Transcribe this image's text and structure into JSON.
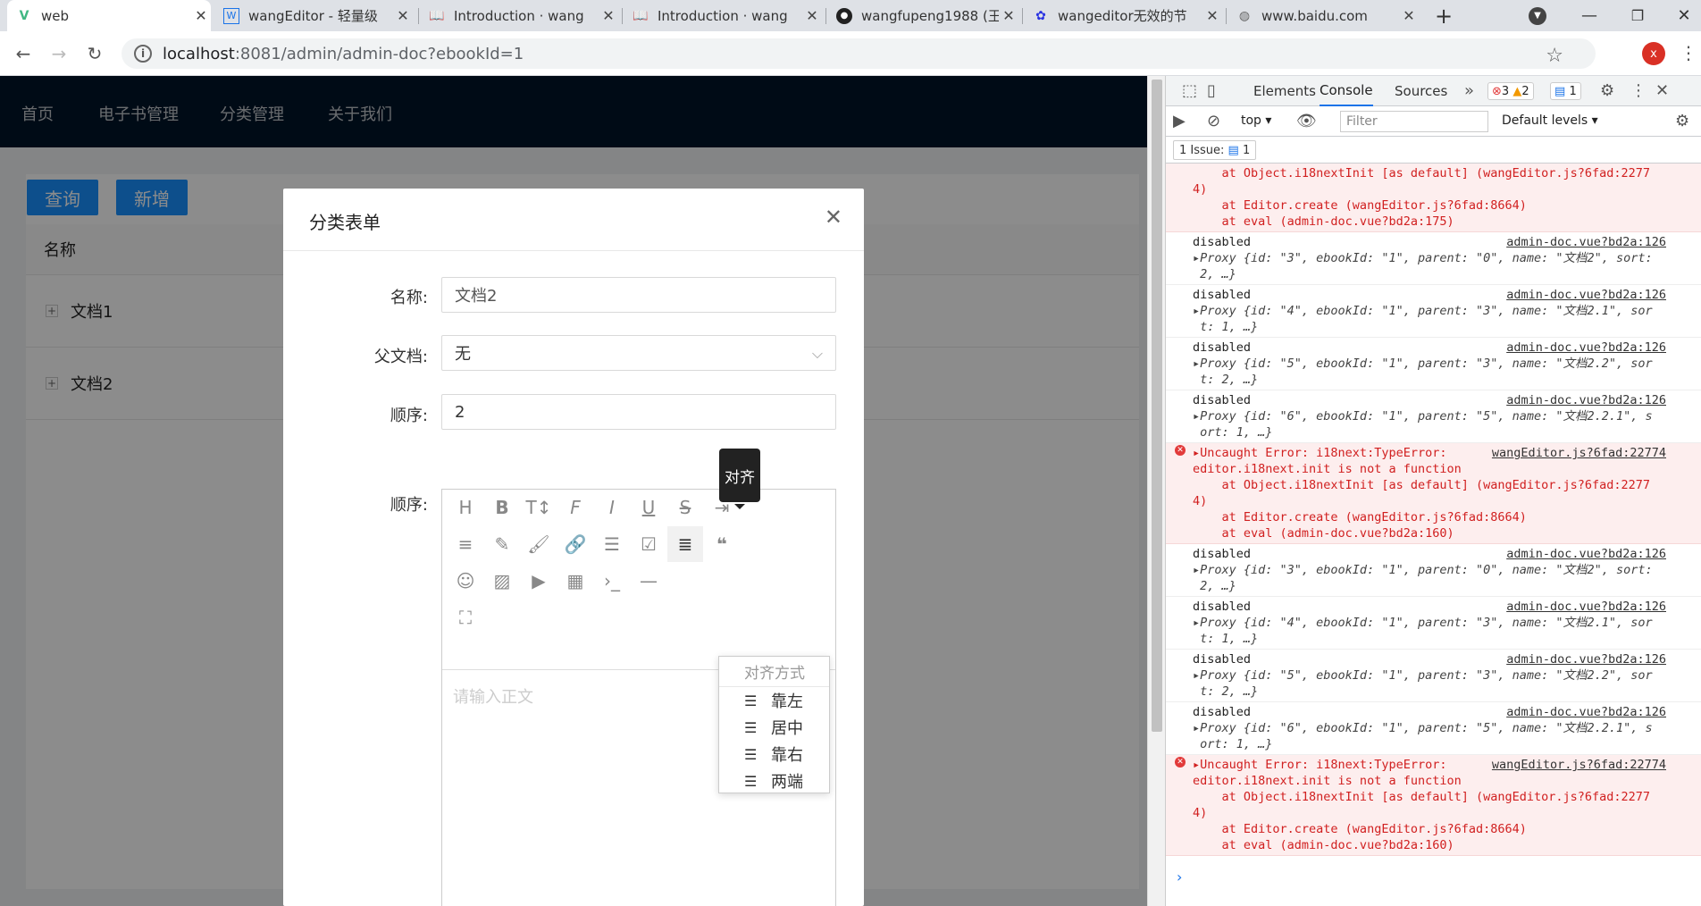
{
  "tabs": [
    {
      "title": "web",
      "icon": "vue-logo-icon"
    },
    {
      "title": "wangEditor - 轻量级",
      "icon": "wangeditor-icon"
    },
    {
      "title": "Introduction · wang",
      "icon": "book-icon"
    },
    {
      "title": "Introduction · wang",
      "icon": "book-icon"
    },
    {
      "title": "wangfupeng1988 (王",
      "icon": "github-icon"
    },
    {
      "title": "wangeditor无效的节",
      "icon": "baidu-paw-icon"
    },
    {
      "title": "www.baidu.com",
      "icon": "globe-icon"
    }
  ],
  "address": {
    "host": "localhost",
    "path": ":8081/admin/admin-doc?ebookId=1",
    "profile_initial": "x"
  },
  "app": {
    "nav": [
      "首页",
      "电子书管理",
      "分类管理",
      "关于我们"
    ],
    "buttons": {
      "query": "查询",
      "add": "新增"
    },
    "table_header": "名称",
    "rows": [
      "文档1",
      "文档2"
    ]
  },
  "modal": {
    "title": "分类表单",
    "fields": {
      "name_label": "名称:",
      "name_value": "文档2",
      "parent_label": "父文档:",
      "parent_value": "无",
      "sort_label": "顺序:",
      "sort_value": "2",
      "content_label": "顺序:"
    },
    "editor": {
      "placeholder": "请输入正文",
      "tooltip": "对齐",
      "align_title": "对齐方式",
      "align_options": [
        "靠左",
        "居中",
        "靠右",
        "两端"
      ]
    }
  },
  "devtools": {
    "tabs": [
      "Elements",
      "Console",
      "Sources"
    ],
    "errors": "3",
    "warnings": "2",
    "messages": "1",
    "context": "top",
    "filter_placeholder": "Filter",
    "levels": "Default levels",
    "issue_label": "1 Issue:",
    "issue_count": "1",
    "log": [
      {
        "type": "err-cont",
        "lines": [
          "    at Object.i18nextInit [as default] (wangEditor.js?6fad:2277",
          "4)",
          "    at Editor.create (wangEditor.js?6fad:8664)",
          "    at eval (admin-doc.vue?bd2a:175)"
        ]
      },
      {
        "type": "log",
        "src": "admin-doc.vue?bd2a:126",
        "lines": [
          "disabled",
          "Proxy {id: \"3\", ebookId: \"1\", parent: \"0\", name: \"文档2\", sort:",
          " 2, …}"
        ]
      },
      {
        "type": "log",
        "src": "admin-doc.vue?bd2a:126",
        "lines": [
          "disabled",
          "Proxy {id: \"4\", ebookId: \"1\", parent: \"3\", name: \"文档2.1\", sor",
          " t: 1, …}"
        ]
      },
      {
        "type": "log",
        "src": "admin-doc.vue?bd2a:126",
        "lines": [
          "disabled",
          "Proxy {id: \"5\", ebookId: \"1\", parent: \"3\", name: \"文档2.2\", sor",
          " t: 2, …}"
        ]
      },
      {
        "type": "log",
        "src": "admin-doc.vue?bd2a:126",
        "lines": [
          "disabled",
          "Proxy {id: \"6\", ebookId: \"1\", parent: \"5\", name: \"文档2.2.1\", s",
          " ort: 1, …}"
        ]
      },
      {
        "type": "err",
        "src": "wangEditor.js?6fad:22774",
        "lines": [
          "Uncaught Error: i18next:TypeError:",
          "editor.i18next.init is not a function",
          "    at Object.i18nextInit [as default] (wangEditor.js?6fad:2277",
          "4)",
          "    at Editor.create (wangEditor.js?6fad:8664)",
          "    at eval (admin-doc.vue?bd2a:160)"
        ]
      },
      {
        "type": "log",
        "src": "admin-doc.vue?bd2a:126",
        "lines": [
          "disabled",
          "Proxy {id: \"3\", ebookId: \"1\", parent: \"0\", name: \"文档2\", sort:",
          " 2, …}"
        ]
      },
      {
        "type": "log",
        "src": "admin-doc.vue?bd2a:126",
        "lines": [
          "disabled",
          "Proxy {id: \"4\", ebookId: \"1\", parent: \"3\", name: \"文档2.1\", sor",
          " t: 1, …}"
        ]
      },
      {
        "type": "log",
        "src": "admin-doc.vue?bd2a:126",
        "lines": [
          "disabled",
          "Proxy {id: \"5\", ebookId: \"1\", parent: \"3\", name: \"文档2.2\", sor",
          " t: 2, …}"
        ]
      },
      {
        "type": "log",
        "src": "admin-doc.vue?bd2a:126",
        "lines": [
          "disabled",
          "Proxy {id: \"6\", ebookId: \"1\", parent: \"5\", name: \"文档2.2.1\", s",
          " ort: 1, …}"
        ]
      },
      {
        "type": "err",
        "src": "wangEditor.js?6fad:22774",
        "lines": [
          "Uncaught Error: i18next:TypeError:",
          "editor.i18next.init is not a function",
          "    at Object.i18nextInit [as default] (wangEditor.js?6fad:2277",
          "4)",
          "    at Editor.create (wangEditor.js?6fad:8664)",
          "    at eval (admin-doc.vue?bd2a:160)"
        ]
      }
    ]
  },
  "colors": {
    "primary": "#1890ff",
    "header": "#001529",
    "error": "#d12020",
    "devtools_accent": "#1a73e8"
  }
}
